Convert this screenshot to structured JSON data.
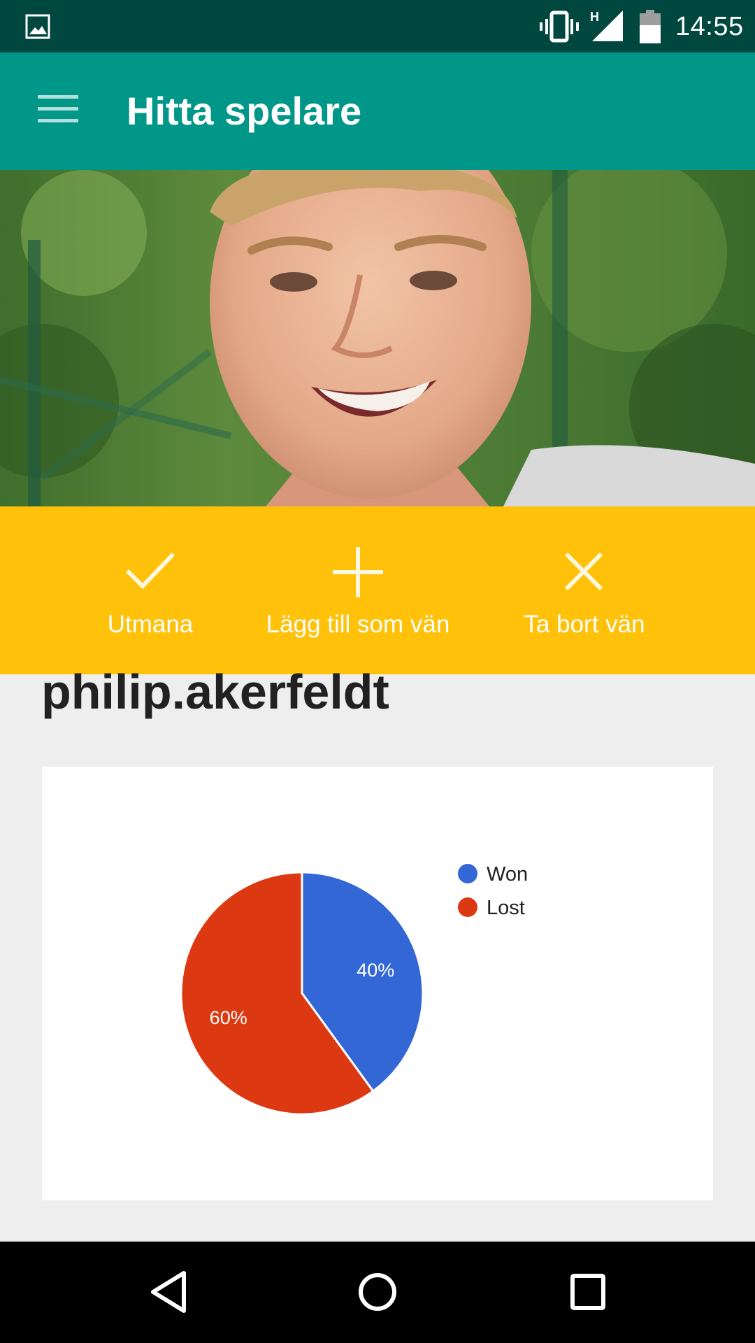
{
  "status_bar": {
    "time": "14:55",
    "network": "H",
    "icons": [
      "image-notification-icon",
      "vibrate-icon",
      "cellular-signal-icon",
      "battery-icon"
    ]
  },
  "app_bar": {
    "title": "Hitta spelare",
    "menu_icon": "hamburger-menu-icon"
  },
  "profile": {
    "photo": "profile-photo",
    "username": "philip.akerfeldt"
  },
  "actions": [
    {
      "label": "Utmana",
      "icon": "check-icon"
    },
    {
      "label": "Lägg till som vän",
      "icon": "plus-icon"
    },
    {
      "label": "Ta bort vän",
      "icon": "close-icon"
    }
  ],
  "chart_data": {
    "type": "pie",
    "title": "",
    "categories": [
      "Won",
      "Lost"
    ],
    "values": [
      40,
      60
    ],
    "labels": [
      "40%",
      "60%"
    ],
    "colors": [
      "#3367d6",
      "#dc3912"
    ],
    "legend_position": "right"
  },
  "nav_bar": {
    "icons": [
      "back-icon",
      "home-icon",
      "recents-icon"
    ]
  },
  "colors": {
    "status_bar": "#00483f",
    "app_bar": "#009688",
    "action_bar": "#ffc10a",
    "background": "#eeeeee"
  }
}
